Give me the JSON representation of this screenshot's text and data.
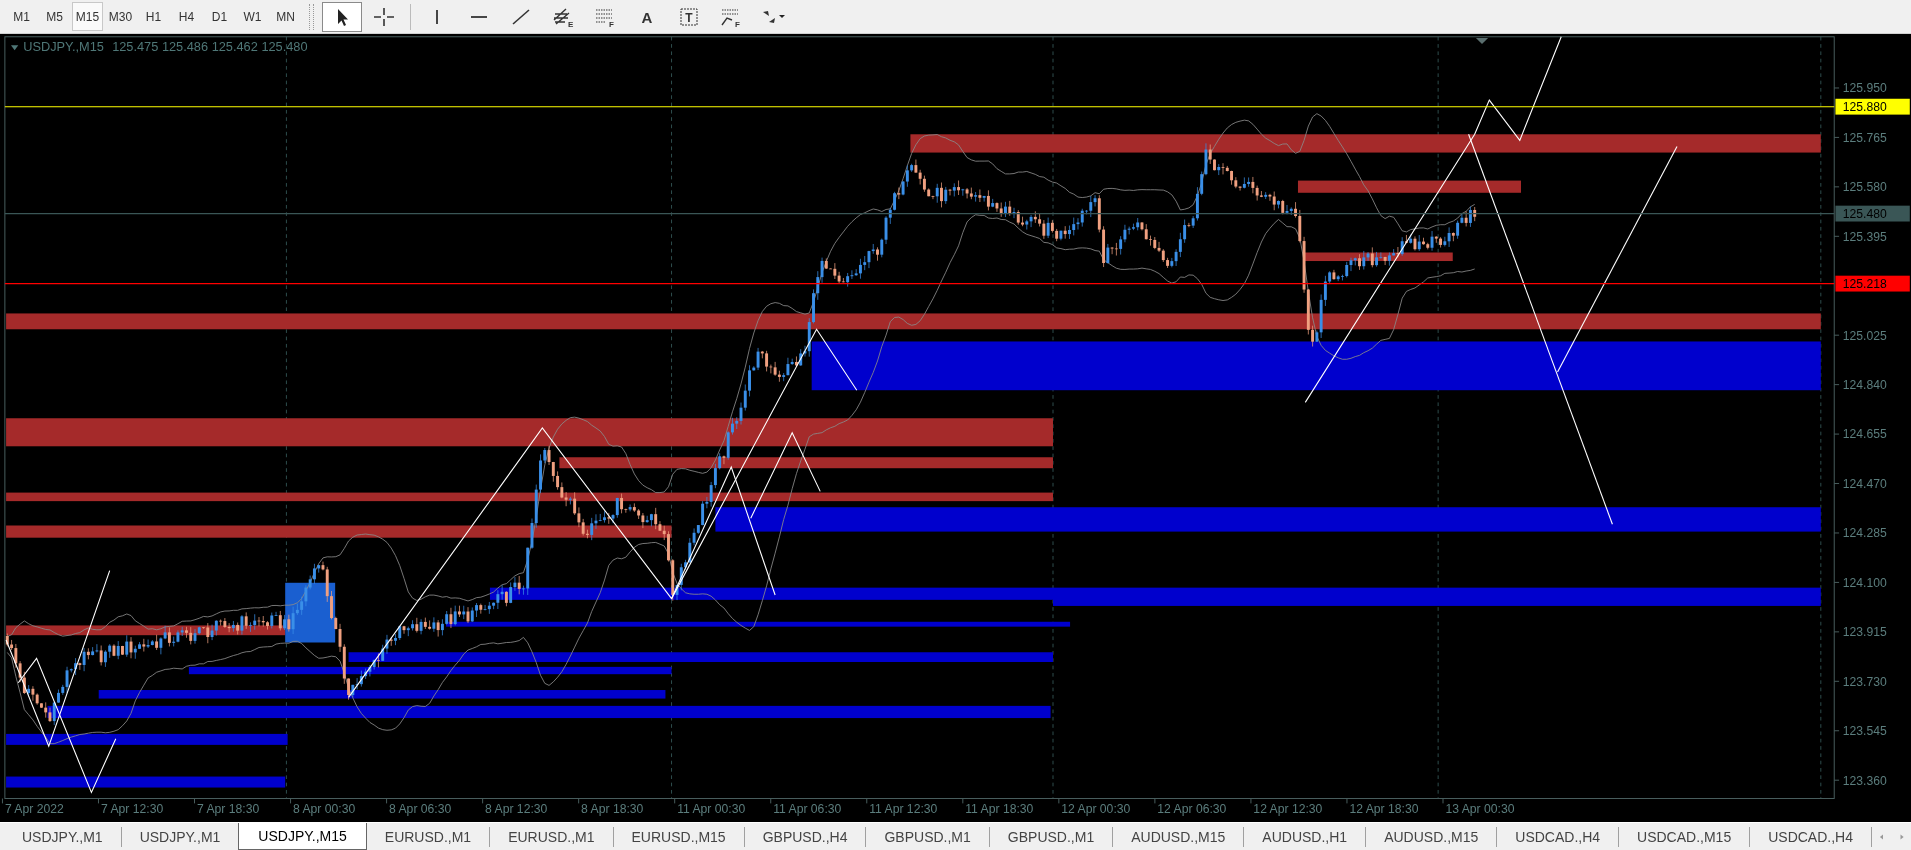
{
  "toolbar": {
    "timeframes": [
      {
        "label": "M1",
        "selected": false
      },
      {
        "label": "M5",
        "selected": false
      },
      {
        "label": "M15",
        "selected": true
      },
      {
        "label": "M30",
        "selected": false
      },
      {
        "label": "H1",
        "selected": false
      },
      {
        "label": "H4",
        "selected": false
      },
      {
        "label": "D1",
        "selected": false
      },
      {
        "label": "W1",
        "selected": false
      },
      {
        "label": "MN",
        "selected": false
      }
    ],
    "tools": [
      {
        "kind": "cursor",
        "selected": true
      },
      {
        "kind": "crosshair",
        "selected": false
      },
      {
        "kind": "vline",
        "selected": false
      },
      {
        "kind": "hline",
        "selected": false
      },
      {
        "kind": "trendline",
        "selected": false
      },
      {
        "kind": "channel",
        "mark": "E",
        "selected": false
      },
      {
        "kind": "fibo",
        "mark": "F",
        "selected": false
      },
      {
        "kind": "text",
        "glyph": "A",
        "selected": false
      },
      {
        "kind": "label",
        "glyph": "T",
        "selected": false
      },
      {
        "kind": "fan",
        "mark": "F",
        "selected": false
      },
      {
        "kind": "arrows",
        "selected": false
      }
    ]
  },
  "chart": {
    "symbol": "USDJPY.,M15",
    "quote": "125.475 125.486 125.462 125.480",
    "price_axis": [
      "125.950",
      "125.765",
      "125.580",
      "125.395",
      "125.025",
      "124.840",
      "124.655",
      "124.470",
      "124.285",
      "124.100",
      "123.915",
      "123.730",
      "123.545",
      "123.360"
    ],
    "price_markers": [
      {
        "label": "125.880",
        "color": "#ffff00"
      },
      {
        "label": "125.480",
        "color": "#3a5656"
      },
      {
        "label": "125.218",
        "color": "#ff0000"
      }
    ],
    "time_axis": [
      "7 Apr 2022",
      "7 Apr 12:30",
      "7 Apr 18:30",
      "8 Apr 00:30",
      "8 Apr 06:30",
      "8 Apr 12:30",
      "8 Apr 18:30",
      "11 Apr 00:30",
      "11 Apr 06:30",
      "11 Apr 12:30",
      "11 Apr 18:30",
      "12 Apr 00:30",
      "12 Apr 06:30",
      "12 Apr 12:30",
      "12 Apr 18:30",
      "13 Apr 00:30"
    ]
  },
  "tabs": [
    {
      "label": "USDJPY.,M1",
      "selected": false
    },
    {
      "label": "USDJPY.,M1",
      "selected": false
    },
    {
      "label": "USDJPY.,M15",
      "selected": true
    },
    {
      "label": "EURUSD.,M1",
      "selected": false
    },
    {
      "label": "EURUSD.,M1",
      "selected": false
    },
    {
      "label": "EURUSD.,M15",
      "selected": false
    },
    {
      "label": "GBPUSD.,H4",
      "selected": false
    },
    {
      "label": "GBPUSD.,M1",
      "selected": false
    },
    {
      "label": "GBPUSD.,M1",
      "selected": false
    },
    {
      "label": "AUDUSD.,M15",
      "selected": false
    },
    {
      "label": "AUDUSD.,H1",
      "selected": false
    },
    {
      "label": "AUDUSD.,M15",
      "selected": false
    },
    {
      "label": "USDCAD.,H4",
      "selected": false
    },
    {
      "label": "USDCAD.,M15",
      "selected": false
    },
    {
      "label": "USDCAD.,H4",
      "selected": false
    }
  ]
}
